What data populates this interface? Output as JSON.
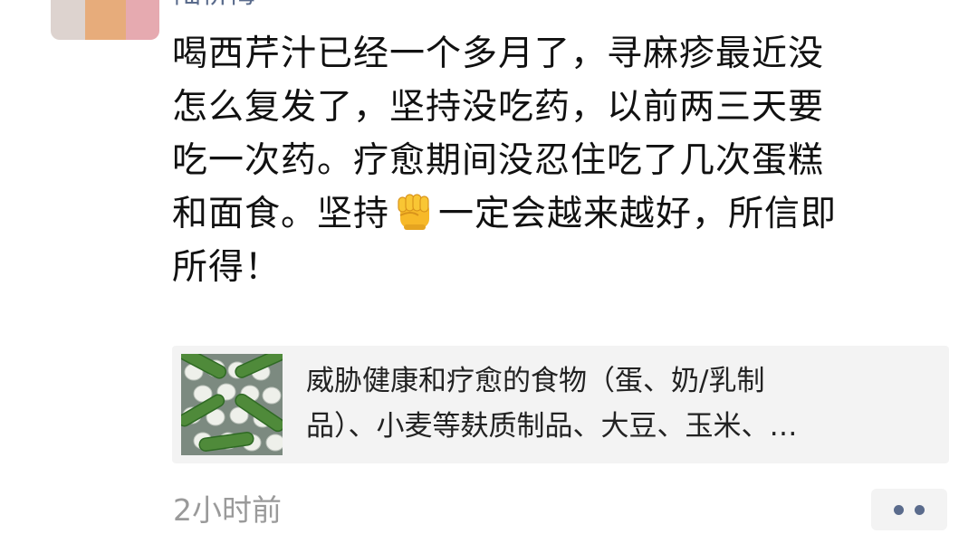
{
  "comment": {
    "username": "陆桥梅",
    "lines": [
      "喝西芹汁已经一个多月了，寻麻疹最近没",
      "怎么复发了，坚持没吃药，以前两三天要",
      "吃一次药。疗愈期间没忍住吃了几次蛋糕",
      "和面食。坚持",
      "一定会越来越好，所信即",
      "所得！"
    ],
    "emoji": "raised-fist",
    "time": "2小时前"
  },
  "link_card": {
    "line1": "威胁健康和疗愈的食物（蛋、奶/乳制",
    "line2": "品）、小麦等麸质制品、大豆、玉米、…",
    "thumbnail": "eggs-and-cucumbers-image"
  },
  "colors": {
    "username": "#5a6b8c",
    "card_background": "#f3f3f3",
    "time": "#9a9a9a"
  }
}
